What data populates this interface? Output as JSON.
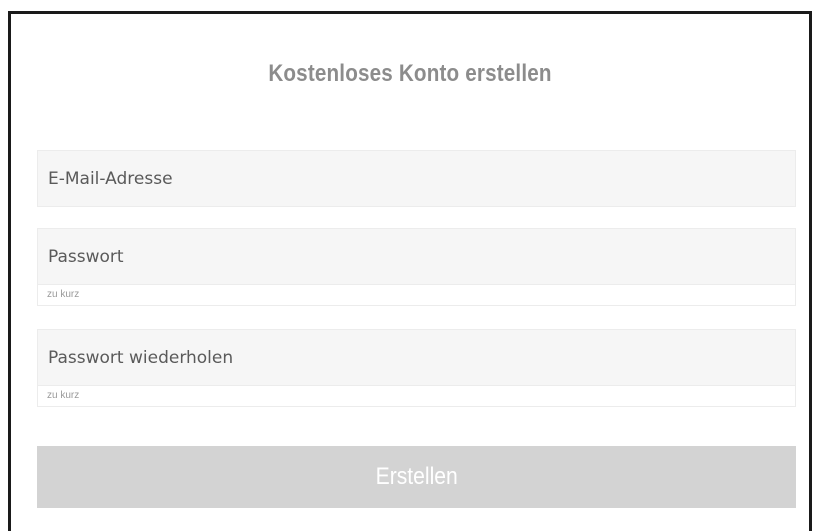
{
  "form": {
    "title": "Kostenloses Konto erstellen",
    "email": {
      "placeholder": "E-Mail-Adresse",
      "value": ""
    },
    "password": {
      "placeholder": "Passwort",
      "value": "",
      "hint": "zu kurz"
    },
    "password_repeat": {
      "placeholder": "Passwort wiederholen",
      "value": "",
      "hint": "zu kurz"
    },
    "submit_label": "Erstellen"
  },
  "colors": {
    "title": "#8c8c8c",
    "field_background": "#f6f6f6",
    "button_background": "#d3d3d3",
    "button_text": "#ffffff",
    "hint_text": "#9a9a9a"
  }
}
